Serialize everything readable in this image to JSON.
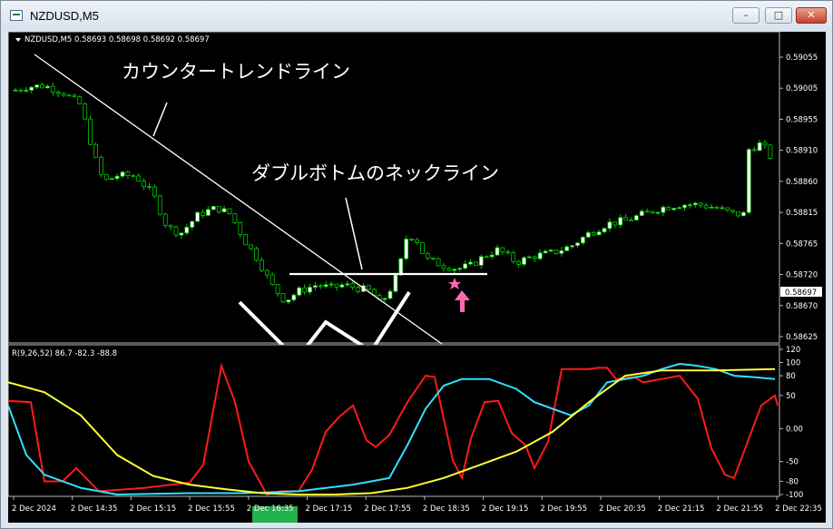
{
  "window": {
    "title": "NZDUSD,M5",
    "buttons": {
      "minimize": "–",
      "maximize": "□",
      "close": "✕"
    }
  },
  "main_chart": {
    "header": "NZDUSD,M5  0.58693 0.58698 0.58692 0.58697",
    "price_labels": [
      "0.59055",
      "0.59005",
      "0.58955",
      "0.58910",
      "0.58860",
      "0.58815",
      "0.58765",
      "0.58720",
      "0.58670",
      "0.58625"
    ],
    "current_price": "0.58697",
    "annotations": {
      "counter_trend": "カウンタートレンドライン",
      "double_bottom": "ダブルボトムのネックライン"
    },
    "colors": {
      "bull_body": "#ffffff",
      "bear_body": "#000000",
      "candle_outline": "#00c800",
      "annotation_line": "#ffffff",
      "star": "#ff69b4",
      "arrow": "#ff69b4"
    },
    "icons": [
      "star-icon",
      "up-arrow-icon"
    ]
  },
  "indicator": {
    "label": "R(9,26,52) 86.7 -82.3 -88.8",
    "scale_labels": [
      "120",
      "100",
      "80",
      "50",
      "0.00",
      "-50",
      "-80",
      "-100"
    ],
    "colors": {
      "line1": "#ff1a1a",
      "line2": "#33e0ff",
      "line3": "#ffff33"
    }
  },
  "time_axis": {
    "labels": [
      "2 Dec 2024",
      "2 Dec 14:35",
      "2 Dec 15:15",
      "2 Dec 15:55",
      "2 Dec 16:35",
      "2 Dec 17:15",
      "2 Dec 17:55",
      "2 Dec 18:35",
      "2 Dec 19:15",
      "2 Dec 19:55",
      "2 Dec 20:35",
      "2 Dec 21:15",
      "2 Dec 21:55",
      "2 Dec 22:35"
    ],
    "highlight_color": "#22b14c"
  },
  "chart_data": {
    "type": "candlestick",
    "title": "NZDUSD,M5",
    "x": [
      "2 Dec 2024",
      "2 Dec 14:35",
      "2 Dec 15:15",
      "2 Dec 15:55",
      "2 Dec 16:35",
      "2 Dec 17:15",
      "2 Dec 17:55",
      "2 Dec 18:35",
      "2 Dec 19:15",
      "2 Dec 19:55",
      "2 Dec 20:35",
      "2 Dec 21:15",
      "2 Dec 21:55",
      "2 Dec 22:35"
    ],
    "close_path": [
      [
        0,
        0.59
      ],
      [
        20,
        0.59008
      ],
      [
        40,
        0.5901
      ],
      [
        60,
        0.59
      ],
      [
        80,
        0.5898
      ],
      [
        95,
        0.589
      ],
      [
        105,
        0.5886
      ],
      [
        120,
        0.5887
      ],
      [
        140,
        0.5887
      ],
      [
        160,
        0.5884
      ],
      [
        175,
        0.5879
      ],
      [
        190,
        0.5878
      ],
      [
        210,
        0.5881
      ],
      [
        230,
        0.5882
      ],
      [
        245,
        0.5881
      ],
      [
        260,
        0.5877
      ],
      [
        275,
        0.5874
      ],
      [
        290,
        0.587
      ],
      [
        305,
        0.58675
      ],
      [
        320,
        0.5869
      ],
      [
        340,
        0.587
      ],
      [
        355,
        0.58695
      ],
      [
        370,
        0.587
      ],
      [
        385,
        0.58695
      ],
      [
        400,
        0.5869
      ],
      [
        410,
        0.5867
      ],
      [
        420,
        0.5869
      ],
      [
        430,
        0.5872
      ],
      [
        440,
        0.5878
      ],
      [
        450,
        0.5877
      ],
      [
        460,
        0.5874
      ],
      [
        480,
        0.5873
      ],
      [
        495,
        0.58725
      ],
      [
        510,
        0.5873
      ],
      [
        525,
        0.58745
      ],
      [
        540,
        0.58755
      ],
      [
        560,
        0.58735
      ],
      [
        580,
        0.58745
      ],
      [
        600,
        0.5875
      ],
      [
        620,
        0.5876
      ],
      [
        640,
        0.5878
      ],
      [
        660,
        0.58795
      ],
      [
        680,
        0.588
      ],
      [
        700,
        0.5881
      ],
      [
        720,
        0.5882
      ],
      [
        740,
        0.58825
      ],
      [
        760,
        0.58825
      ],
      [
        780,
        0.5882
      ],
      [
        800,
        0.5881
      ],
      [
        812,
        0.5881
      ],
      [
        815,
        0.5891
      ],
      [
        830,
        0.5892
      ],
      [
        845,
        0.5889
      ]
    ],
    "ylim": [
      0.58625,
      0.5906
    ],
    "oscillator": {
      "name": "R(9,26,52)",
      "ylim": [
        -100,
        120
      ],
      "series": [
        {
          "values": [
            [
              0,
              42
            ],
            [
              25,
              40
            ],
            [
              40,
              -80
            ],
            [
              60,
              -80
            ],
            [
              75,
              -60
            ],
            [
              100,
              -95
            ],
            [
              150,
              -90
            ],
            [
              180,
              -85
            ],
            [
              200,
              -82
            ],
            [
              215,
              -55
            ],
            [
              235,
              95
            ],
            [
              250,
              40
            ],
            [
              265,
              -50
            ],
            [
              285,
              -100
            ],
            [
              300,
              -95
            ],
            [
              320,
              -95
            ],
            [
              335,
              -62
            ],
            [
              350,
              -5
            ],
            [
              365,
              18
            ],
            [
              380,
              35
            ],
            [
              395,
              -18
            ],
            [
              405,
              -28
            ],
            [
              420,
              -10
            ],
            [
              440,
              40
            ],
            [
              460,
              80
            ],
            [
              470,
              78
            ],
            [
              490,
              -48
            ],
            [
              500,
              -75
            ],
            [
              510,
              -15
            ],
            [
              525,
              40
            ],
            [
              540,
              42
            ],
            [
              555,
              -7
            ],
            [
              570,
              -25
            ],
            [
              580,
              -60
            ],
            [
              595,
              -20
            ],
            [
              610,
              90
            ],
            [
              640,
              90
            ],
            [
              650,
              92
            ],
            [
              660,
              92
            ],
            [
              670,
              75
            ],
            [
              690,
              78
            ],
            [
              700,
              70
            ],
            [
              720,
              75
            ],
            [
              740,
              80
            ],
            [
              760,
              45
            ],
            [
              775,
              -30
            ],
            [
              790,
              -70
            ],
            [
              800,
              -75
            ],
            [
              815,
              -20
            ],
            [
              830,
              35
            ],
            [
              845,
              50
            ],
            [
              848,
              35
            ]
          ]
        },
        {
          "values": [
            [
              0,
              35
            ],
            [
              20,
              -40
            ],
            [
              40,
              -70
            ],
            [
              80,
              -90
            ],
            [
              120,
              -100
            ],
            [
              200,
              -98
            ],
            [
              260,
              -98
            ],
            [
              320,
              -95
            ],
            [
              380,
              -85
            ],
            [
              420,
              -75
            ],
            [
              440,
              -25
            ],
            [
              460,
              30
            ],
            [
              480,
              65
            ],
            [
              500,
              75
            ],
            [
              530,
              75
            ],
            [
              560,
              60
            ],
            [
              580,
              40
            ],
            [
              600,
              30
            ],
            [
              620,
              20
            ],
            [
              640,
              35
            ],
            [
              660,
              70
            ],
            [
              700,
              80
            ],
            [
              720,
              90
            ],
            [
              740,
              98
            ],
            [
              760,
              95
            ],
            [
              780,
              90
            ],
            [
              800,
              80
            ],
            [
              820,
              78
            ],
            [
              845,
              75
            ]
          ]
        },
        {
          "values": [
            [
              0,
              70
            ],
            [
              40,
              55
            ],
            [
              80,
              20
            ],
            [
              120,
              -40
            ],
            [
              160,
              -72
            ],
            [
              200,
              -85
            ],
            [
              240,
              -92
            ],
            [
              280,
              -98
            ],
            [
              320,
              -100
            ],
            [
              360,
              -100
            ],
            [
              400,
              -98
            ],
            [
              440,
              -90
            ],
            [
              480,
              -75
            ],
            [
              520,
              -55
            ],
            [
              560,
              -35
            ],
            [
              600,
              -5
            ],
            [
              640,
              40
            ],
            [
              680,
              80
            ],
            [
              720,
              88
            ],
            [
              780,
              88
            ],
            [
              845,
              90
            ]
          ]
        }
      ]
    }
  }
}
